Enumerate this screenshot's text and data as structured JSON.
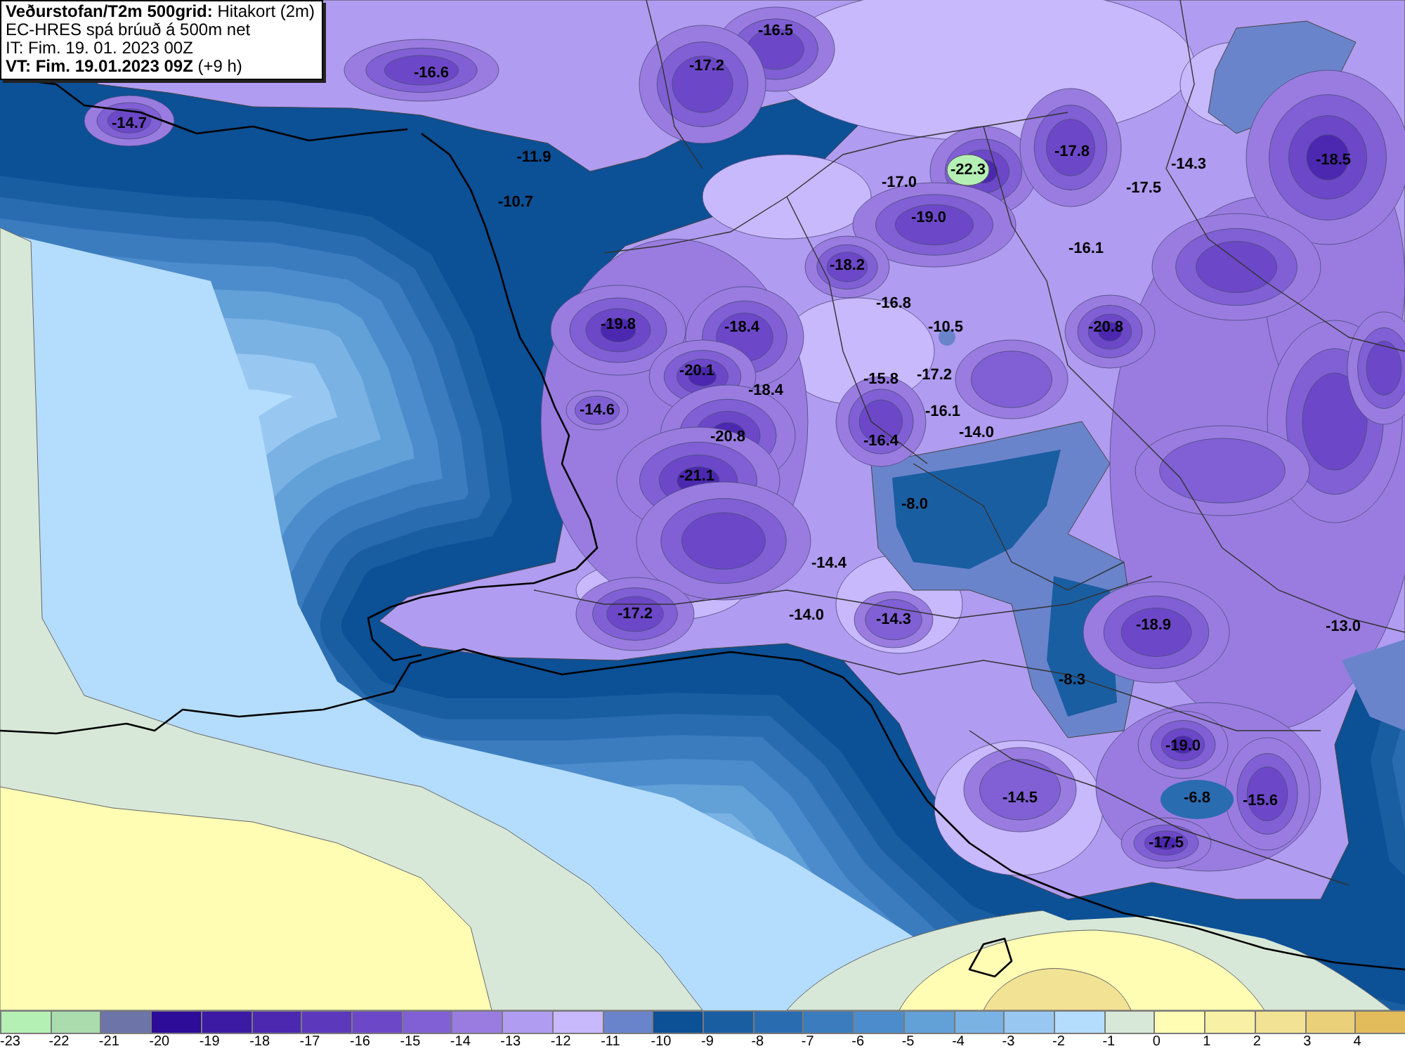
{
  "info_box": {
    "lines": [
      "**Veðurstofan/T2m 500grid:** Hitakort (2m)",
      "EC-HRES spá brúuð á 500m net",
      "IT: Fim. 19. 01. 2023 00Z",
      "**VT: Fim. 19.01.2023 09Z** (+9 h)"
    ]
  },
  "map": {
    "labels": [
      "-16.5",
      "-17.2",
      "-16.6",
      "-14.7",
      "-17.8",
      "-11.9",
      "-14.3",
      "-18.5",
      "-22.3",
      "-17.0",
      "-17.5",
      "-10.7",
      "-19.0",
      "-16.1",
      "-18.2",
      "-16.8",
      "-19.8",
      "-18.4",
      "-10.5",
      "-20.8",
      "-20.1",
      "-15.8",
      "-17.2",
      "-18.4",
      "-14.6",
      "-16.1",
      "-14.0",
      "-20.8",
      "-16.4",
      "-21.1",
      "-8.0",
      "-14.4",
      "-17.2",
      "-14.0",
      "-14.3",
      "-18.9",
      "-13.0",
      "-8.3",
      "-19.0",
      "-14.5",
      "-6.8",
      "-15.6",
      "-17.5"
    ]
  },
  "legend": {
    "items": [
      {
        "label": "-23",
        "color": "#b4f0b4"
      },
      {
        "label": "-22",
        "color": "#aadcae"
      },
      {
        "label": "-21",
        "color": "#6c74a8"
      },
      {
        "label": "-20",
        "color": "#2c0c98"
      },
      {
        "label": "-19",
        "color": "#3c1aa4"
      },
      {
        "label": "-18",
        "color": "#4c28b0"
      },
      {
        "label": "-17",
        "color": "#5c38bc"
      },
      {
        "label": "-16",
        "color": "#6c48c8"
      },
      {
        "label": "-15",
        "color": "#8060d4"
      },
      {
        "label": "-14",
        "color": "#9a7ce0"
      },
      {
        "label": "-13",
        "color": "#b09cf0"
      },
      {
        "label": "-12",
        "color": "#c8b8fc"
      },
      {
        "label": "-11",
        "color": "#6a84cc"
      },
      {
        "label": "-10",
        "color": "#0c5096"
      },
      {
        "label": "-9",
        "color": "#1a5ea2"
      },
      {
        "label": "-8",
        "color": "#2a6cb0"
      },
      {
        "label": "-7",
        "color": "#3a7cbe"
      },
      {
        "label": "-6",
        "color": "#4c8ccc"
      },
      {
        "label": "-5",
        "color": "#62a0d8"
      },
      {
        "label": "-4",
        "color": "#7ab2e4"
      },
      {
        "label": "-3",
        "color": "#98c8f2"
      },
      {
        "label": "-2",
        "color": "#b4dcfc"
      },
      {
        "label": "-1",
        "color": "#d8e8d8"
      },
      {
        "label": "0",
        "color": "#fffcb4"
      },
      {
        "label": "1",
        "color": "#f8f0a4"
      },
      {
        "label": "2",
        "color": "#f2e294"
      },
      {
        "label": "3",
        "color": "#ebd07a"
      },
      {
        "label": "4",
        "color": "#e2bc5a"
      }
    ]
  }
}
